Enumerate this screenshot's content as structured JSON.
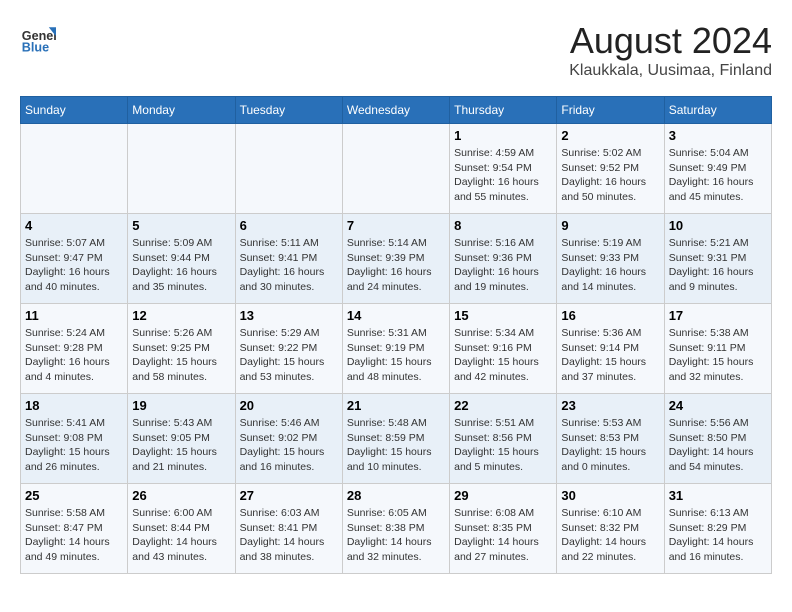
{
  "logo": {
    "line1": "General",
    "line2": "Blue"
  },
  "title": "August 2024",
  "subtitle": "Klaukkala, Uusimaa, Finland",
  "days_of_week": [
    "Sunday",
    "Monday",
    "Tuesday",
    "Wednesday",
    "Thursday",
    "Friday",
    "Saturday"
  ],
  "weeks": [
    {
      "cells": [
        {
          "day": "",
          "info": ""
        },
        {
          "day": "",
          "info": ""
        },
        {
          "day": "",
          "info": ""
        },
        {
          "day": "",
          "info": ""
        },
        {
          "day": "1",
          "info": "Sunrise: 4:59 AM\nSunset: 9:54 PM\nDaylight: 16 hours\nand 55 minutes."
        },
        {
          "day": "2",
          "info": "Sunrise: 5:02 AM\nSunset: 9:52 PM\nDaylight: 16 hours\nand 50 minutes."
        },
        {
          "day": "3",
          "info": "Sunrise: 5:04 AM\nSunset: 9:49 PM\nDaylight: 16 hours\nand 45 minutes."
        }
      ]
    },
    {
      "cells": [
        {
          "day": "4",
          "info": "Sunrise: 5:07 AM\nSunset: 9:47 PM\nDaylight: 16 hours\nand 40 minutes."
        },
        {
          "day": "5",
          "info": "Sunrise: 5:09 AM\nSunset: 9:44 PM\nDaylight: 16 hours\nand 35 minutes."
        },
        {
          "day": "6",
          "info": "Sunrise: 5:11 AM\nSunset: 9:41 PM\nDaylight: 16 hours\nand 30 minutes."
        },
        {
          "day": "7",
          "info": "Sunrise: 5:14 AM\nSunset: 9:39 PM\nDaylight: 16 hours\nand 24 minutes."
        },
        {
          "day": "8",
          "info": "Sunrise: 5:16 AM\nSunset: 9:36 PM\nDaylight: 16 hours\nand 19 minutes."
        },
        {
          "day": "9",
          "info": "Sunrise: 5:19 AM\nSunset: 9:33 PM\nDaylight: 16 hours\nand 14 minutes."
        },
        {
          "day": "10",
          "info": "Sunrise: 5:21 AM\nSunset: 9:31 PM\nDaylight: 16 hours\nand 9 minutes."
        }
      ]
    },
    {
      "cells": [
        {
          "day": "11",
          "info": "Sunrise: 5:24 AM\nSunset: 9:28 PM\nDaylight: 16 hours\nand 4 minutes."
        },
        {
          "day": "12",
          "info": "Sunrise: 5:26 AM\nSunset: 9:25 PM\nDaylight: 15 hours\nand 58 minutes."
        },
        {
          "day": "13",
          "info": "Sunrise: 5:29 AM\nSunset: 9:22 PM\nDaylight: 15 hours\nand 53 minutes."
        },
        {
          "day": "14",
          "info": "Sunrise: 5:31 AM\nSunset: 9:19 PM\nDaylight: 15 hours\nand 48 minutes."
        },
        {
          "day": "15",
          "info": "Sunrise: 5:34 AM\nSunset: 9:16 PM\nDaylight: 15 hours\nand 42 minutes."
        },
        {
          "day": "16",
          "info": "Sunrise: 5:36 AM\nSunset: 9:14 PM\nDaylight: 15 hours\nand 37 minutes."
        },
        {
          "day": "17",
          "info": "Sunrise: 5:38 AM\nSunset: 9:11 PM\nDaylight: 15 hours\nand 32 minutes."
        }
      ]
    },
    {
      "cells": [
        {
          "day": "18",
          "info": "Sunrise: 5:41 AM\nSunset: 9:08 PM\nDaylight: 15 hours\nand 26 minutes."
        },
        {
          "day": "19",
          "info": "Sunrise: 5:43 AM\nSunset: 9:05 PM\nDaylight: 15 hours\nand 21 minutes."
        },
        {
          "day": "20",
          "info": "Sunrise: 5:46 AM\nSunset: 9:02 PM\nDaylight: 15 hours\nand 16 minutes."
        },
        {
          "day": "21",
          "info": "Sunrise: 5:48 AM\nSunset: 8:59 PM\nDaylight: 15 hours\nand 10 minutes."
        },
        {
          "day": "22",
          "info": "Sunrise: 5:51 AM\nSunset: 8:56 PM\nDaylight: 15 hours\nand 5 minutes."
        },
        {
          "day": "23",
          "info": "Sunrise: 5:53 AM\nSunset: 8:53 PM\nDaylight: 15 hours\nand 0 minutes."
        },
        {
          "day": "24",
          "info": "Sunrise: 5:56 AM\nSunset: 8:50 PM\nDaylight: 14 hours\nand 54 minutes."
        }
      ]
    },
    {
      "cells": [
        {
          "day": "25",
          "info": "Sunrise: 5:58 AM\nSunset: 8:47 PM\nDaylight: 14 hours\nand 49 minutes."
        },
        {
          "day": "26",
          "info": "Sunrise: 6:00 AM\nSunset: 8:44 PM\nDaylight: 14 hours\nand 43 minutes."
        },
        {
          "day": "27",
          "info": "Sunrise: 6:03 AM\nSunset: 8:41 PM\nDaylight: 14 hours\nand 38 minutes."
        },
        {
          "day": "28",
          "info": "Sunrise: 6:05 AM\nSunset: 8:38 PM\nDaylight: 14 hours\nand 32 minutes."
        },
        {
          "day": "29",
          "info": "Sunrise: 6:08 AM\nSunset: 8:35 PM\nDaylight: 14 hours\nand 27 minutes."
        },
        {
          "day": "30",
          "info": "Sunrise: 6:10 AM\nSunset: 8:32 PM\nDaylight: 14 hours\nand 22 minutes."
        },
        {
          "day": "31",
          "info": "Sunrise: 6:13 AM\nSunset: 8:29 PM\nDaylight: 14 hours\nand 16 minutes."
        }
      ]
    }
  ]
}
